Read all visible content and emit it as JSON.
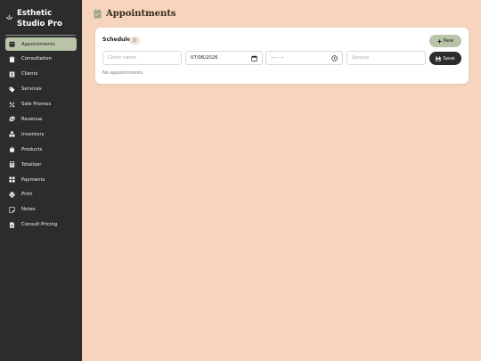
{
  "brand": {
    "name": "Esthetic Studio Pro",
    "icon": "lotus-icon"
  },
  "sidebar": {
    "items": [
      {
        "label": "Appointments",
        "icon": "calendar-icon",
        "active": true
      },
      {
        "label": "Consultation",
        "icon": "clipboard-icon",
        "active": false
      },
      {
        "label": "Clients",
        "icon": "contact-icon",
        "active": false
      },
      {
        "label": "Services",
        "icon": "tag-icon",
        "active": false
      },
      {
        "label": "Sale Promos",
        "icon": "percent-icon",
        "active": false
      },
      {
        "label": "Revenue",
        "icon": "money-icon",
        "active": false
      },
      {
        "label": "Inventory",
        "icon": "boxes-icon",
        "active": false
      },
      {
        "label": "Products",
        "icon": "bag-icon",
        "active": false
      },
      {
        "label": "Totalizer",
        "icon": "calculator-icon",
        "active": false
      },
      {
        "label": "Payments",
        "icon": "grid-icon",
        "active": false
      },
      {
        "label": "Print",
        "icon": "printer-icon",
        "active": false
      },
      {
        "label": "Notes",
        "icon": "note-icon",
        "active": false
      },
      {
        "label": "Consult Pricing",
        "icon": "document-icon",
        "active": false
      }
    ]
  },
  "page": {
    "title": "Appointments",
    "icon": "calendar-icon"
  },
  "schedule": {
    "label": "Schedule",
    "count": "0",
    "new_label": "New",
    "client_placeholder": "Client name",
    "date_value": "07/06/2026",
    "time_value": "--:-- --",
    "service_placeholder": "Service",
    "save_label": "Save",
    "empty_message": "No appointments."
  },
  "colors": {
    "background": "#f6d4bd",
    "sidebar": "#2c2c2c",
    "accent": "#b8c4a7",
    "card": "#ffffff"
  }
}
